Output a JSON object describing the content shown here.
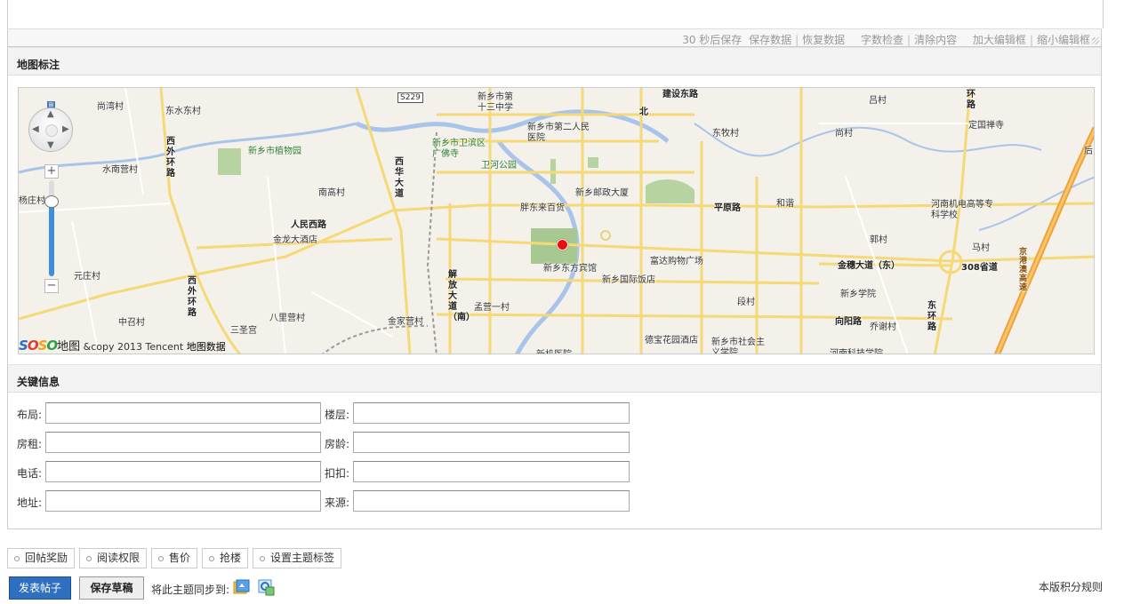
{
  "editor": {
    "autosave": "30 秒后保存",
    "tools": [
      "保存数据",
      "恢复数据",
      "字数检查",
      "清除内容",
      "加大编辑框",
      "缩小编辑框"
    ]
  },
  "map_section": {
    "title": "地图标注",
    "zoom_level_fraction": 0.78,
    "places": [
      "尚湾村",
      "东水东村",
      "新乡市第十三中学",
      "建设东路",
      "北",
      "吕村",
      "环路",
      "定国禅寺",
      "新乡市第二人民医院",
      "新乡市植物园",
      "新乡市卫滨区广佛寺",
      "卫河公园",
      "东牧村",
      "尚村",
      "后",
      "水南营村",
      "西外环路",
      "西华大道",
      "新乡邮政大厦",
      "杨庄村",
      "南高村",
      "胖东来百货",
      "平原路",
      "和谐",
      "河南机电高等专科学校",
      "人民西路",
      "金龙大酒店",
      "郭村",
      "马村",
      "富达购物广场",
      "金穗大道（东）",
      "308省道",
      "元庄村",
      "新乡东方宾馆",
      "解放大道（南）",
      "新乡国际饭店",
      "新乡学院",
      "京港澳高速",
      "西外环路",
      "孟营一村",
      "段村",
      "东环路",
      "中召村",
      "八里营村",
      "金家营村",
      "向阳路",
      "乔谢村",
      "三圣宫",
      "德宝花园酒店",
      "新乡市社会主义学院",
      "新机医院",
      "河南科技学院",
      "S229"
    ],
    "logo_text": "地图",
    "copyright": "&copy 2013 Tencent",
    "map_data_link": "地图数据",
    "zoom_in": "+",
    "zoom_out": "−"
  },
  "key_info": {
    "title": "关键信息",
    "fields": [
      {
        "label": "布局:",
        "value": ""
      },
      {
        "label": "楼层:",
        "value": ""
      },
      {
        "label": "房租:",
        "value": ""
      },
      {
        "label": "房龄:",
        "value": ""
      },
      {
        "label": "电话:",
        "value": ""
      },
      {
        "label": "扣扣:",
        "value": ""
      },
      {
        "label": "地址:",
        "value": ""
      },
      {
        "label": "来源:",
        "value": ""
      }
    ]
  },
  "options": [
    "回帖奖励",
    "阅读权限",
    "售价",
    "抢楼",
    "设置主题标签"
  ],
  "actions": {
    "publish": "发表帖子",
    "save_draft": "保存草稿",
    "sync_label": "将此主题同步到:",
    "rules": "本版积分规则"
  },
  "colors": {
    "primary_button": "#2f6fc0",
    "marker": "#e8100f",
    "road_yellow": "#f5d977",
    "river": "#a9c4ea",
    "park": "#b7d3a1",
    "highway": "#f0a23a"
  }
}
